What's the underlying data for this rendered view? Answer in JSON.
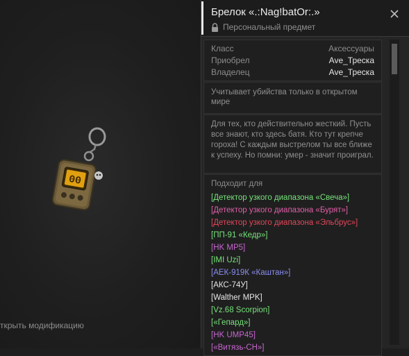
{
  "left": {
    "modify_hint": "ткрыть модификацию"
  },
  "header": {
    "title": "Брелок «.:Nag!batOr:.»",
    "subtitle": "Персональный предмет"
  },
  "info": [
    {
      "key": "Класс",
      "value": "Аксессуары",
      "muted": true
    },
    {
      "key": "Приобрел",
      "value": "Ave_Треска",
      "muted": false
    },
    {
      "key": "Владелец",
      "value": "Ave_Треска",
      "muted": false
    }
  ],
  "note": "Учитывает убийства только в открытом мире",
  "description": "Для тех, кто действительно жесткий. Пусть все знают, кто здесь батя. Кто тут крепче гороха! С каждым выстрелом ты все ближе к успеху. Но помни: умер - значит проиграл.",
  "fits": {
    "title": "Подходит для",
    "items": [
      {
        "label": "[Детектор узкого диапазона «Свеча»]",
        "color": "#76e27a"
      },
      {
        "label": "[Детектор узкого диапазона «Бурят»]",
        "color": "#e05fa8"
      },
      {
        "label": "[Детектор узкого диапазона «Эльбрус»]",
        "color": "#e0475a"
      },
      {
        "label": "[ПП-91 «Кедр»]",
        "color": "#76e27a"
      },
      {
        "label": "[HK MP5]",
        "color": "#c766d0"
      },
      {
        "label": "[IMI Uzi]",
        "color": "#76e27a"
      },
      {
        "label": "[АЕК-919К «Каштан»]",
        "color": "#8a8ef0"
      },
      {
        "label": "[АКС-74У]",
        "color": "#e6e6e6"
      },
      {
        "label": "[Walther MPK]",
        "color": "#e6e6e6"
      },
      {
        "label": "[Vz.68 Scorpion]",
        "color": "#76e27a"
      },
      {
        "label": "[«Гепард»]",
        "color": "#76e27a"
      },
      {
        "label": "[HK UMP45]",
        "color": "#c766d0"
      },
      {
        "label": "[«Витязь-СН»]",
        "color": "#c766d0"
      }
    ]
  },
  "icons": {
    "close": "close-icon",
    "lock": "lock-icon",
    "item": "keychain-image"
  }
}
